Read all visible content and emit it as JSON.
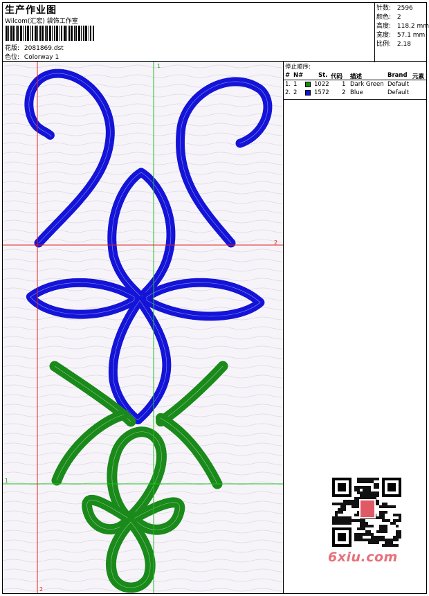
{
  "header": {
    "title": "生产作业图",
    "studio": "Wilcom(汇宏) 袋饰工作室",
    "design_label": "花版:",
    "design_value": "2081869.dst",
    "colorway_label": "色位:",
    "colorway_value": "Colorway 1"
  },
  "specs": [
    {
      "label": "针数:",
      "value": "2596"
    },
    {
      "label": "颜色:",
      "value": "2"
    },
    {
      "label": "高度:",
      "value": "118.2 mm"
    },
    {
      "label": "宽度:",
      "value": "57.1 mm"
    },
    {
      "label": "比例:",
      "value": "2.18"
    }
  ],
  "stop_sequence": {
    "title": "停止顺序:",
    "columns": [
      "#",
      "N#",
      "St.",
      "代码",
      "描述",
      "Brand",
      "元素"
    ],
    "rows": [
      {
        "index": "1.",
        "needle": "1",
        "color": "#1a8a1a",
        "stitches": "1022",
        "code": "1",
        "description": "Dark Green",
        "brand": "Default"
      },
      {
        "index": "2.",
        "needle": "2",
        "color": "#1010e0",
        "stitches": "1572",
        "code": "2",
        "description": "Blue",
        "brand": "Default"
      }
    ]
  },
  "guides": {
    "top_v": "1",
    "right_h": "2",
    "left_h": "1",
    "bottom_v": "2"
  },
  "colors": {
    "green": "#1a8a1a",
    "blue": "#1414d8",
    "red_guide": "#e02020",
    "green_guide": "#20c020"
  },
  "watermark": "6xiu.com"
}
